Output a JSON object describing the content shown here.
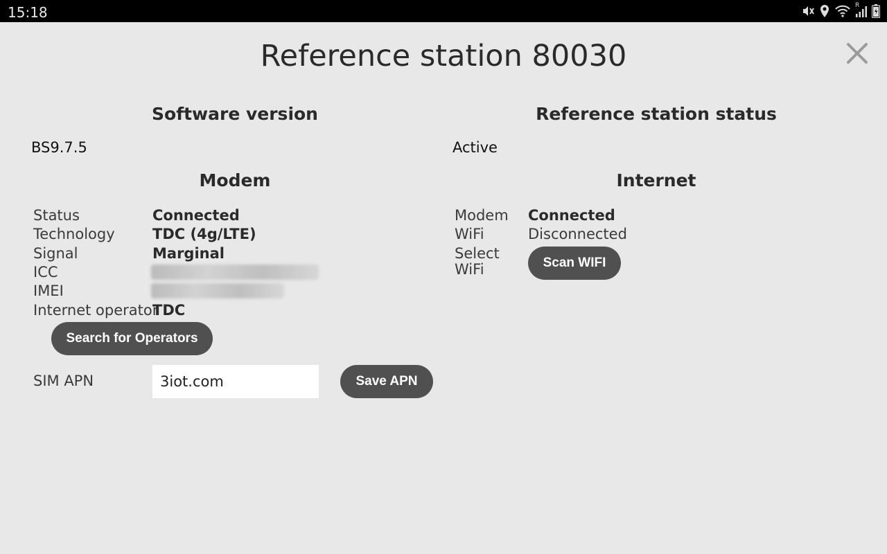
{
  "statusbar": {
    "time": "15:18",
    "icons": [
      "mute-icon",
      "location-icon",
      "wifi-icon",
      "signal-icon",
      "battery-icon"
    ],
    "roaming": "R"
  },
  "title": "Reference station 80030",
  "software": {
    "heading": "Software version",
    "value": "BS9.7.5"
  },
  "station_status": {
    "heading": "Reference station status",
    "value": "Active"
  },
  "modem": {
    "heading": "Modem",
    "rows": [
      {
        "label": "Status",
        "value": "Connected"
      },
      {
        "label": "Technology",
        "value": "TDC (4g/LTE)"
      },
      {
        "label": "Signal",
        "value": "Marginal"
      },
      {
        "label": "ICC",
        "value": ""
      },
      {
        "label": "IMEI",
        "value": ""
      },
      {
        "label": "Internet operator",
        "value": "TDC"
      }
    ],
    "search_button": "Search for Operators",
    "apn_label": "SIM APN",
    "apn_value": "3iot.com",
    "save_button": "Save APN"
  },
  "internet": {
    "heading": "Internet",
    "rows": [
      {
        "label": "Modem",
        "value": "Connected"
      },
      {
        "label": "WiFi",
        "value": "Disconnected"
      }
    ],
    "select_wifi_label": "Select WiFi",
    "scan_button": "Scan WIFI"
  },
  "colors": {
    "background": "#e8e8e8",
    "statusbar": "#000000",
    "button": "#505050",
    "text": "#2a2a2a"
  }
}
